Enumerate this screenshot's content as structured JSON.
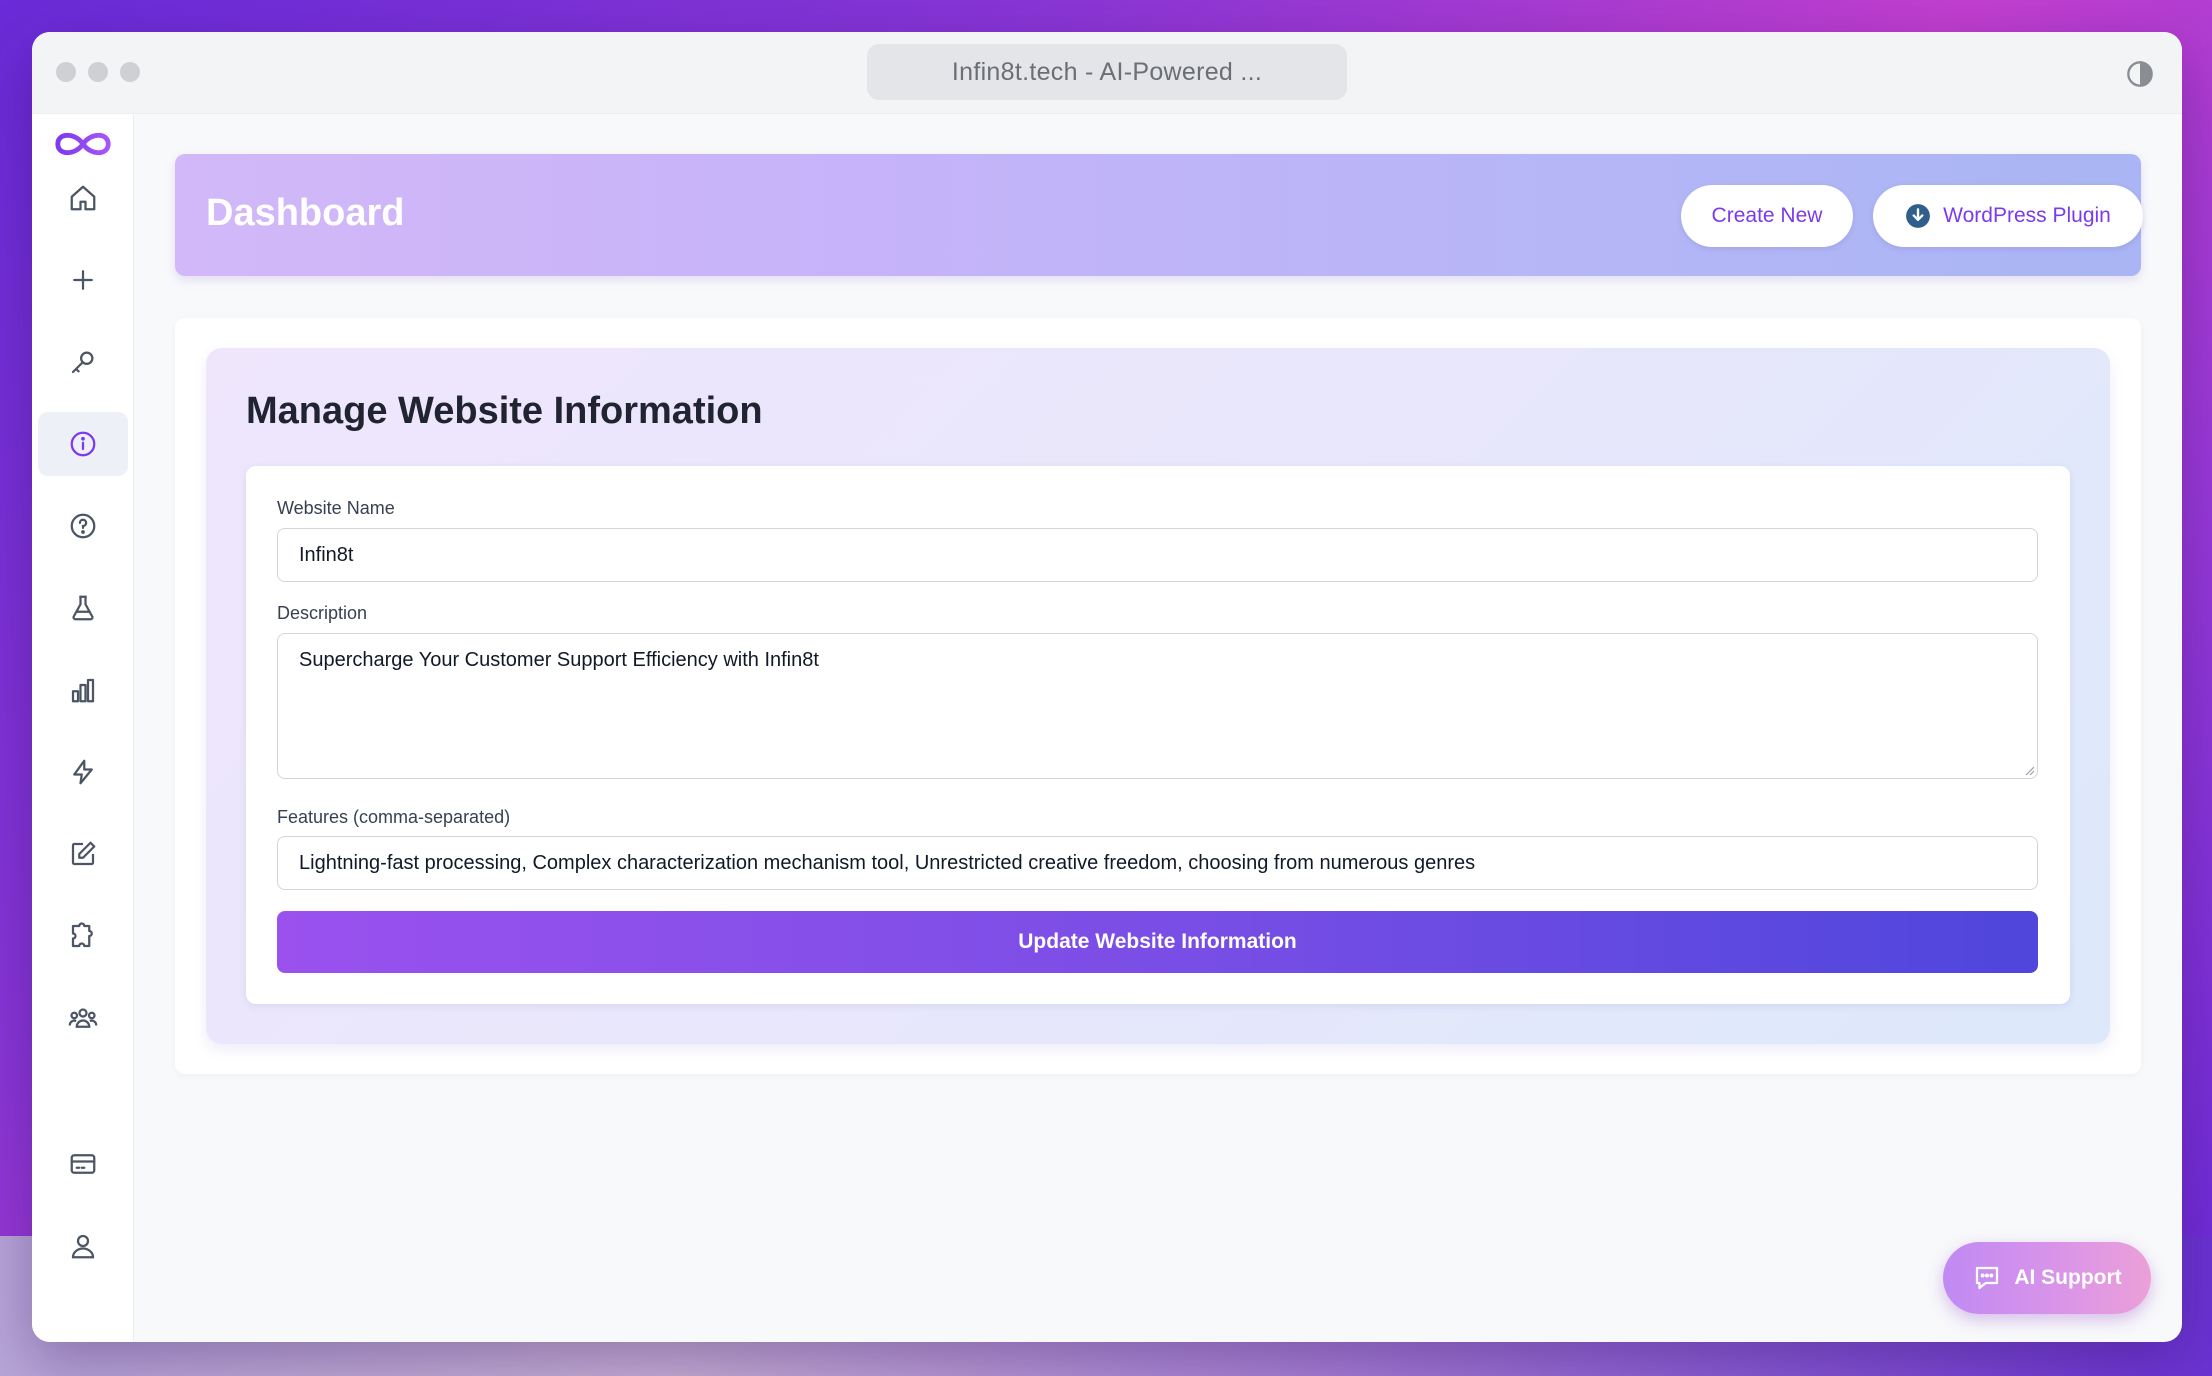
{
  "window": {
    "url_title": "Infin8t.tech - AI-Powered ..."
  },
  "sidebar": {
    "items": [
      {
        "icon": "home-icon"
      },
      {
        "icon": "plus-icon"
      },
      {
        "icon": "key-icon"
      },
      {
        "icon": "info-icon",
        "active": true
      },
      {
        "icon": "help-icon"
      },
      {
        "icon": "flask-icon"
      },
      {
        "icon": "bar-chart-icon"
      },
      {
        "icon": "lightning-icon"
      },
      {
        "icon": "edit-icon"
      },
      {
        "icon": "puzzle-icon"
      },
      {
        "icon": "team-icon"
      },
      {
        "icon": "credit-card-icon"
      },
      {
        "icon": "user-icon"
      }
    ]
  },
  "header": {
    "title": "Dashboard",
    "create_label": "Create New",
    "wordpress_label": "WordPress Plugin"
  },
  "panel": {
    "title": "Manage Website Information"
  },
  "form": {
    "website_name_label": "Website Name",
    "website_name_value": "Infin8t",
    "description_label": "Description",
    "description_value": "Supercharge Your Customer Support Efficiency with Infin8t",
    "features_label": "Features (comma-separated)",
    "features_value": "Lightning-fast processing, Complex characterization mechanism tool, Unrestricted creative freedom, choosing from numerous genres",
    "submit_label": "Update Website Information"
  },
  "support": {
    "label": "AI Support"
  },
  "colors": {
    "accent": "#7c3aed",
    "button_gradient_start": "#9a51ee",
    "button_gradient_end": "#4f46dc"
  }
}
